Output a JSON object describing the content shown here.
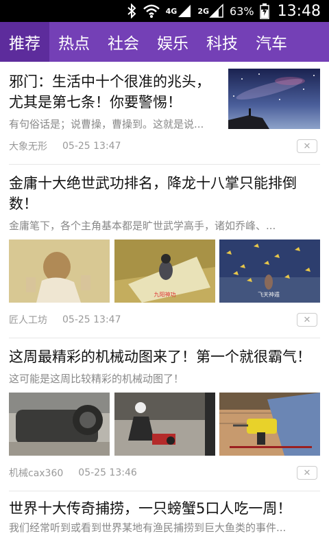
{
  "status_bar": {
    "network_1": "4G",
    "network_2": "2G",
    "battery": "63%",
    "time": "13:48"
  },
  "tabs": [
    {
      "label": "推荐",
      "active": true
    },
    {
      "label": "热点",
      "active": false
    },
    {
      "label": "社会",
      "active": false
    },
    {
      "label": "娱乐",
      "active": false
    },
    {
      "label": "科技",
      "active": false
    },
    {
      "label": "汽车",
      "active": false
    }
  ],
  "feed": {
    "items": [
      {
        "title": "邪门：生活中十个很准的兆头，尤其是第七条！你要警惕！",
        "summary": "有句俗话是；说曹操，曹操到。这就是说...",
        "source": "大象无形",
        "time": "05-25 13:47",
        "close": "✕"
      },
      {
        "title": "金庸十大绝世武功排名，降龙十八掌只能排倒数！",
        "summary": "金庸笔下，各个主角基本都是旷世武学高手，诸如乔峰、...",
        "source": "匠人工坊",
        "time": "05-25 13:47",
        "close": "✕",
        "image_captions": [
          "",
          "九阳神功",
          "飞天神遁"
        ]
      },
      {
        "title": "这周最精彩的机械动图来了！第一个就很霸气！",
        "summary": "这可能是这周比较精彩的机械动图了！",
        "source": "机械cax360",
        "time": "05-25 13:46",
        "close": "✕"
      },
      {
        "title": "世界十大传奇捕捞，一只螃蟹5口人吃一周！",
        "summary": "我们经常听到或看到世界某地有渔民捕捞到巨大鱼类的事件..."
      }
    ]
  }
}
